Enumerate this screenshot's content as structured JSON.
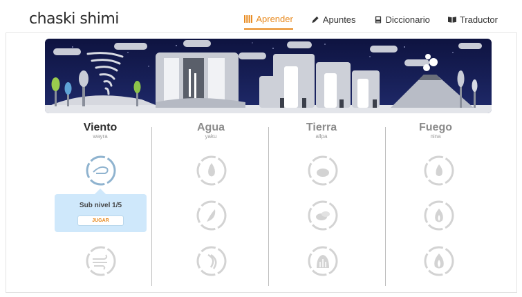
{
  "app": {
    "logo": "chaski shimi"
  },
  "nav": [
    {
      "label": "Aprender",
      "icon": "bars-icon",
      "active": true
    },
    {
      "label": "Apuntes",
      "icon": "pencil-icon",
      "active": false
    },
    {
      "label": "Diccionario",
      "icon": "book-icon",
      "active": false
    },
    {
      "label": "Traductor",
      "icon": "open-book-icon",
      "active": false
    }
  ],
  "columns": [
    {
      "title": "Viento",
      "subtitle": "wayra"
    },
    {
      "title": "Agua",
      "subtitle": "yaku"
    },
    {
      "title": "Tierra",
      "subtitle": "allpa"
    },
    {
      "title": "Fuego",
      "subtitle": "nina"
    }
  ],
  "popup": {
    "title": "Sub nivel 1/5",
    "button": "JUGAR"
  },
  "colors": {
    "accent": "#e8891d",
    "popup_bg": "#cfe8fb",
    "night_sky": "#141a4a"
  }
}
